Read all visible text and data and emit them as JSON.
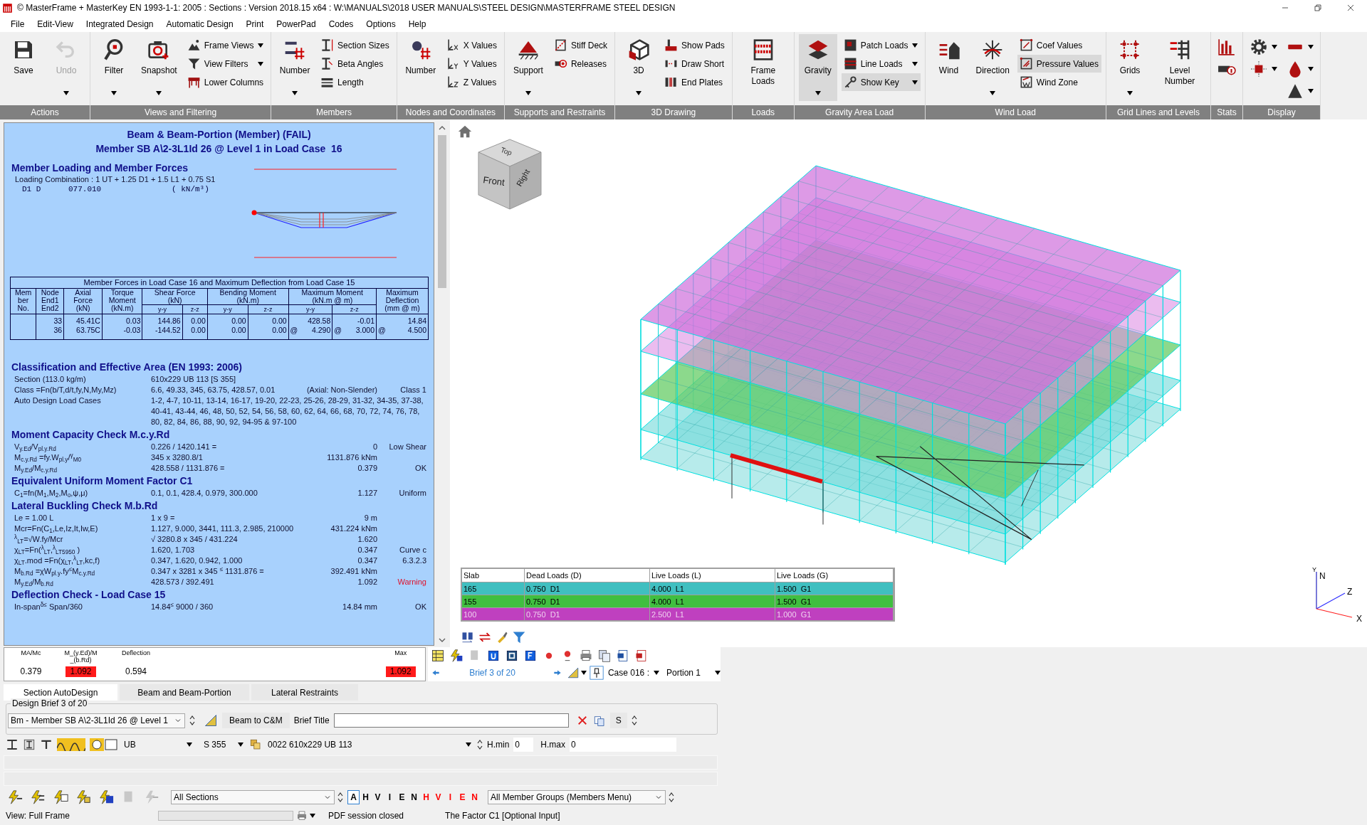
{
  "window": {
    "title": "© MasterFrame + MasterKey EN 1993-1-1: 2005 : Sections : Version 2018.15 x64 : W:\\MANUALS\\2018 USER MANUALS\\STEEL DESIGN\\MASTERFRAME STEEL DESIGN"
  },
  "menu": [
    "File",
    "Edit-View",
    "Integrated Design",
    "Automatic Design",
    "Print",
    "PowerPad",
    "Codes",
    "Options",
    "Help"
  ],
  "ribbon": [
    {
      "label": "Actions",
      "columns": [
        [
          {
            "kind": "large",
            "label": "Save",
            "dropdown": false,
            "disabled": false,
            "selected": false
          }
        ],
        [
          {
            "kind": "large",
            "label": "Undo",
            "dropdown": true,
            "disabled": true,
            "selected": false
          }
        ]
      ]
    },
    {
      "label": "Views and Filtering",
      "columns": [
        [
          {
            "kind": "large",
            "label": "Filter",
            "dropdown": true,
            "disabled": false,
            "selected": false
          }
        ],
        [
          {
            "kind": "large",
            "label": "Snapshot",
            "dropdown": true,
            "disabled": false,
            "selected": false
          }
        ],
        [
          {
            "kind": "small",
            "label": "Frame Views",
            "dropdown": true,
            "disabled": false,
            "selected": false
          },
          {
            "kind": "small",
            "label": "View Filters",
            "dropdown": true,
            "disabled": false,
            "selected": false
          },
          {
            "kind": "small",
            "label": "Lower Columns",
            "dropdown": false,
            "disabled": false,
            "selected": false
          }
        ]
      ]
    },
    {
      "label": "Members",
      "columns": [
        [
          {
            "kind": "large",
            "label": "Number",
            "dropdown": true,
            "disabled": false,
            "selected": false
          }
        ],
        [
          {
            "kind": "small",
            "label": "Section Sizes",
            "dropdown": false,
            "disabled": false,
            "selected": false
          },
          {
            "kind": "small",
            "label": "Beta Angles",
            "dropdown": false,
            "disabled": false,
            "selected": false
          },
          {
            "kind": "small",
            "label": "Length",
            "dropdown": false,
            "disabled": false,
            "selected": false
          }
        ]
      ]
    },
    {
      "label": "Nodes and Coordinates",
      "columns": [
        [
          {
            "kind": "large",
            "label": "Number",
            "dropdown": false,
            "disabled": false,
            "selected": false
          }
        ],
        [
          {
            "kind": "small",
            "label": "X Values",
            "dropdown": false,
            "disabled": false,
            "selected": false
          },
          {
            "kind": "small",
            "label": "Y Values",
            "dropdown": false,
            "disabled": false,
            "selected": false
          },
          {
            "kind": "small",
            "label": "Z Values",
            "dropdown": false,
            "disabled": false,
            "selected": false
          }
        ]
      ]
    },
    {
      "label": "Supports and Restraints",
      "columns": [
        [
          {
            "kind": "large",
            "label": "Support",
            "dropdown": true,
            "disabled": false,
            "selected": false
          }
        ],
        [
          {
            "kind": "small",
            "label": "Stiff Deck",
            "dropdown": false,
            "disabled": false,
            "selected": false
          },
          {
            "kind": "small",
            "label": "Releases",
            "dropdown": false,
            "disabled": false,
            "selected": false
          }
        ]
      ]
    },
    {
      "label": "3D Drawing",
      "columns": [
        [
          {
            "kind": "large",
            "label": "3D",
            "dropdown": true,
            "disabled": false,
            "selected": false
          }
        ],
        [
          {
            "kind": "small",
            "label": "Show Pads",
            "dropdown": false,
            "disabled": false,
            "selected": false
          },
          {
            "kind": "small",
            "label": "Draw Short",
            "dropdown": false,
            "disabled": false,
            "selected": false
          },
          {
            "kind": "small",
            "label": "End Plates",
            "dropdown": false,
            "disabled": false,
            "selected": false
          }
        ]
      ]
    },
    {
      "label": "Loads",
      "columns": [
        [
          {
            "kind": "large",
            "label": "Frame Loads",
            "dropdown": false,
            "disabled": false,
            "selected": false
          }
        ]
      ]
    },
    {
      "label": "Gravity Area Load",
      "columns": [
        [
          {
            "kind": "large",
            "label": "Gravity",
            "dropdown": true,
            "disabled": false,
            "selected": true
          }
        ],
        [
          {
            "kind": "small",
            "label": "Patch Loads",
            "dropdown": true,
            "disabled": false,
            "selected": false
          },
          {
            "kind": "small",
            "label": "Line Loads",
            "dropdown": true,
            "disabled": false,
            "selected": false
          },
          {
            "kind": "small",
            "label": "Show Key",
            "dropdown": true,
            "disabled": false,
            "selected": true
          }
        ]
      ]
    },
    {
      "label": "Wind Load",
      "columns": [
        [
          {
            "kind": "large",
            "label": "Wind",
            "dropdown": false,
            "disabled": false,
            "selected": false
          }
        ],
        [
          {
            "kind": "large",
            "label": "Direction",
            "dropdown": true,
            "disabled": false,
            "selected": false
          }
        ],
        [
          {
            "kind": "small",
            "label": "Coef Values",
            "dropdown": false,
            "disabled": false,
            "selected": false
          },
          {
            "kind": "small",
            "label": "Pressure Values",
            "dropdown": false,
            "disabled": false,
            "selected": true
          },
          {
            "kind": "small",
            "label": "Wind Zone",
            "dropdown": false,
            "disabled": false,
            "selected": false
          }
        ]
      ]
    },
    {
      "label": "Grid Lines and Levels",
      "columns": [
        [
          {
            "kind": "large",
            "label": "Grids",
            "dropdown": true,
            "disabled": false,
            "selected": false
          }
        ],
        [
          {
            "kind": "large",
            "label": "Level Number",
            "dropdown": false,
            "disabled": false,
            "selected": false
          }
        ]
      ]
    },
    {
      "label": "Stats",
      "columns": [
        [
          {
            "kind": "icon",
            "dropdown": false,
            "disabled": false,
            "selected": false
          },
          {
            "kind": "icon",
            "dropdown": false,
            "disabled": false,
            "selected": false
          }
        ]
      ]
    },
    {
      "label": "Display",
      "columns": [
        [
          {
            "kind": "icon",
            "dropdown": true,
            "disabled": false,
            "selected": false
          },
          {
            "kind": "icon",
            "dropdown": true,
            "disabled": false,
            "selected": false
          }
        ],
        [
          {
            "kind": "icon",
            "dropdown": true,
            "disabled": false,
            "selected": false
          },
          {
            "kind": "icon",
            "dropdown": true,
            "disabled": false,
            "selected": false
          },
          {
            "kind": "icon",
            "dropdown": true,
            "disabled": false,
            "selected": false
          }
        ]
      ]
    }
  ],
  "report": {
    "title_lines": [
      "Beam & Beam-Portion (Member) (FAIL)",
      "Member SB A\\2-3L1Id 26 @ Level 1 in Load Case  16"
    ],
    "loading": {
      "heading": "Member Loading and Member Forces",
      "combination": "Loading Combination : 1 UT + 1.25 D1 + 1.5 L1 + 0.75 S1",
      "load_line": [
        "D1 D",
        "077.010",
        "( kN/m³)"
      ]
    },
    "forces_table": {
      "caption": "Member Forces in Load Case 16 and Maximum Deflection from Load Case 15",
      "columns": [
        {
          "label": [
            "Mem",
            "ber",
            "No."
          ]
        },
        {
          "label": [
            "Node",
            "End1",
            "End2"
          ]
        },
        {
          "label": [
            "Axial",
            "Force",
            "(kN)"
          ]
        },
        {
          "label": [
            "Torque",
            "Moment",
            "(kN.m)"
          ]
        },
        {
          "label": [
            "Shear Force",
            "(kN)"
          ],
          "colspan": 2,
          "sub": [
            "y-y",
            "z-z"
          ]
        },
        {
          "label": [
            "Bending Moment",
            "(kN.m)"
          ],
          "colspan": 2,
          "sub": [
            "y-y",
            "z-z"
          ]
        },
        {
          "label": [
            "Maximum Moment",
            "(kN.m @ m)"
          ],
          "colspan": 2,
          "sub": [
            "y-y",
            "z-z"
          ]
        },
        {
          "label": [
            "Maximum",
            "Deflection",
            "(mm @ m)"
          ]
        }
      ],
      "rows": [
        {
          "cells": [
            [],
            [
              {
                "value": "33"
              },
              {
                "value": "36"
              }
            ],
            [
              {
                "value": "45.41C"
              },
              {
                "value": "63.75C"
              }
            ],
            [
              {
                "value": "0.03"
              },
              {
                "value": "-0.03"
              }
            ],
            [
              {
                "value": "144.86"
              },
              {
                "value": "-144.52"
              }
            ],
            [
              {
                "value": "0.00"
              },
              {
                "value": "0.00"
              }
            ],
            [
              {
                "value": "0.00"
              },
              {
                "value": "0.00"
              }
            ],
            [
              {
                "value": "0.00"
              },
              {
                "value": "0.00"
              }
            ],
            [
              {
                "value": "428.58"
              },
              {
                "prefix": "@",
                "value": "4.290"
              }
            ],
            [
              {
                "value": "-0.01"
              },
              {
                "prefix": "@",
                "value": "3.000"
              }
            ],
            [
              {
                "value": "14.84"
              },
              {
                "prefix": "@",
                "value": "4.500"
              }
            ]
          ]
        }
      ]
    },
    "sections": [
      {
        "heading": "Classification and Effective Area (EN 1993: 2006)",
        "rows": [
          {
            "label": "Section (113.0 kg/m)",
            "value": "610x229 UB 113 [S 355]"
          },
          {
            "label": "Class =Fn(b/T,d/t,fy,N,My,Mz)",
            "value": "6.6, 49.33, 345, 63.75, 428.57, 0.01",
            "result": "(Axial: Non-Slender)",
            "note": "Class 1",
            "warning": false
          },
          {
            "label": "Auto Design Load Cases",
            "value": "1-2, 4-7, 10-11, 13-14, 16-17, 19-20, 22-23, 25-26, 28-29, 31-32, 34-35, 37-38, 40-41, 43-44, 46, 48, 50, 52, 54, 56, 58, 60, 62, 64, 66, 68, 70, 72, 74, 76, 78, 80, 82, 84, 86, 88, 90, 92, 94-95 & 97-100"
          }
        ]
      },
      {
        "heading": "Moment Capacity Check M.c.y.Rd",
        "rows": [
          {
            "label": "V$_{y.Ed}$/V$_{pl.y.Rd}$",
            "value": "0.226 / 1420.141 =",
            "result": "0",
            "note": "Low Shear",
            "warning": false
          },
          {
            "label": "M$_{c.y.Rd}$ =fy.W$_{pl.y}$/$^{γ}$$_{M0}$",
            "value": "345 x 3280.8/1",
            "result": "1131.876 kNm"
          },
          {
            "label": "M$_{y.Ed}$/M$_{c.y.Rd}$",
            "value": "428.558 / 1131.876 =",
            "result": "0.379",
            "note": "OK",
            "warning": false
          }
        ]
      },
      {
        "heading": "Equivalent Uniform Moment Factor C1",
        "rows": [
          {
            "label": "C$_{1}$=fn(M$_{1}$,M$_{2}$,M$_{o}$,ψ,μ)",
            "value": "0.1, 0.1, 428.4, 0.979, 300.000",
            "result": "1.127",
            "note": "Uniform",
            "warning": false
          }
        ]
      },
      {
        "heading": "Lateral Buckling Check M.b.Rd",
        "rows": [
          {
            "label": "Le = 1.00 L",
            "value": "1 x 9 =",
            "result": "9 m"
          },
          {
            "label": "Mcr=Fn(C$_{1}$,Le,Iz,It,Iw,E)",
            "value": "1.127, 9.000, 3441, 111.3, 2.985, 210000",
            "result": "431.224 kNm"
          },
          {
            "label": "$^{λ}$$_{LT}$=√W.fy/Mcr",
            "value": "√ 3280.8 x 345 / 431.224",
            "result": "1.620"
          },
          {
            "label": "χ$_{LT}$=Fn($^{λ}$$_{LT}$,$^{λ}$$_{LT5950}$ )",
            "value": "1.620, 1.703",
            "result": "0.347",
            "note": "Curve c",
            "warning": false
          },
          {
            "label": "χ$_{LT}$.mod =Fn(χ$_{LT}$,$^{λ}$$_{LT}$,kc,f)",
            "value": "0.347, 1.620, 0.942, 1.000",
            "result": "0.347",
            "note": "6.3.2.3",
            "warning": false
          },
          {
            "label": "M$_{b.Rd}$ =χW$_{pl.y}$.fy$^{≤}$M$_{c.y.Rd}$",
            "value": "0.347 x 3281 x 345 $^{≤}$ 1131.876 =",
            "result": "392.491 kNm"
          },
          {
            "label": "M$_{y.Ed}$/M$_{b.Rd}$",
            "value": "428.573 / 392.491",
            "result": "1.092",
            "note": "Warning",
            "warning": true
          }
        ]
      },
      {
        "heading": "Deflection Check - Load Case 15",
        "rows": [
          {
            "label": "In-span$^{δ≤}$ Span/360",
            "value": "14.84$^{≤}$ 9000 / 360",
            "result": "14.84 mm",
            "note": "OK",
            "warning": false
          }
        ]
      }
    ]
  },
  "view3d": {
    "cube_faces": [
      "Top",
      "Front",
      "Right"
    ],
    "axes": [
      "Y",
      "N",
      "Z",
      "X"
    ],
    "legend": {
      "columns": [
        "Slab",
        "Dead Loads (D)",
        "Live Loads (L)",
        "Live Loads (G)"
      ],
      "rows": [
        {
          "color": "#40bfc0",
          "dimmed": false,
          "cells": [
            "165",
            "0.750  D1",
            "4.000  L1",
            "1.500  G1"
          ]
        },
        {
          "color": "#40bf40",
          "dimmed": false,
          "cells": [
            "155",
            "0.750  D1",
            "4.000  L1",
            "1.500  G1"
          ]
        },
        {
          "color": "#bf40bf",
          "dimmed": true,
          "cells": [
            "100",
            "0.750  D1",
            "2.500  L1",
            "1.000  G1"
          ]
        }
      ]
    }
  },
  "results": [
    {
      "label": [
        "MA/Mc"
      ],
      "value": "0.379",
      "fail": false
    },
    {
      "label": [
        "M_(y.Ed)/M",
        "_(b.Rd)"
      ],
      "value": "1.092",
      "fail": true
    },
    {
      "label": [
        "Deflection"
      ],
      "value": "0.594",
      "fail": false
    },
    {
      "label": [
        "Max"
      ],
      "value": "1.092",
      "fail": true
    }
  ],
  "navigation": {
    "brief": "Brief 3 of 20",
    "case": "Case 016 :",
    "portion": "Portion 1"
  },
  "tabs": [
    {
      "label": "Section AutoDesign",
      "selected": true
    },
    {
      "label": "Beam and Beam-Portion",
      "selected": false
    },
    {
      "label": "Lateral Restraints",
      "selected": false
    }
  ],
  "design_brief": {
    "legend": "Design Brief 3 of 20",
    "member": "Bm - Member SB A\\2-3L1Id 26 @ Level 1",
    "convert_button": "Beam to C&M",
    "title_label": "Brief Title",
    "s_button": "S"
  },
  "section_row": {
    "type": "UB",
    "grade": "S 355",
    "section": "0022 610x229 UB 113",
    "hmin_label": "H.min",
    "hmin": "0",
    "hmax_label": "H.max",
    "hmax": "0"
  },
  "toolbar": {
    "sections": "All Sections",
    "filters": [
      {
        "label": "A",
        "selected": true,
        "color": "#000000"
      },
      {
        "label": "H",
        "selected": false,
        "color": "#000000"
      },
      {
        "label": "V",
        "selected": false,
        "color": "#000000"
      },
      {
        "label": "I",
        "selected": false,
        "color": "#000000"
      },
      {
        "label": "E",
        "selected": false,
        "color": "#000000"
      },
      {
        "label": "N",
        "selected": false,
        "color": "#000000"
      },
      {
        "label": "H",
        "selected": false,
        "color": "#ff0000"
      },
      {
        "label": "V",
        "selected": false,
        "color": "#ff0000"
      },
      {
        "label": "I",
        "selected": false,
        "color": "#ff0000"
      },
      {
        "label": "E",
        "selected": false,
        "color": "#ff0000"
      },
      {
        "label": "N",
        "selected": false,
        "color": "#ff0000"
      }
    ],
    "groups": "All Member Groups (Members Menu)"
  },
  "status_bar": {
    "view": "View: Full Frame",
    "pdf": "PDF session closed",
    "hint": "The Factor C1 [Optional Input]"
  }
}
